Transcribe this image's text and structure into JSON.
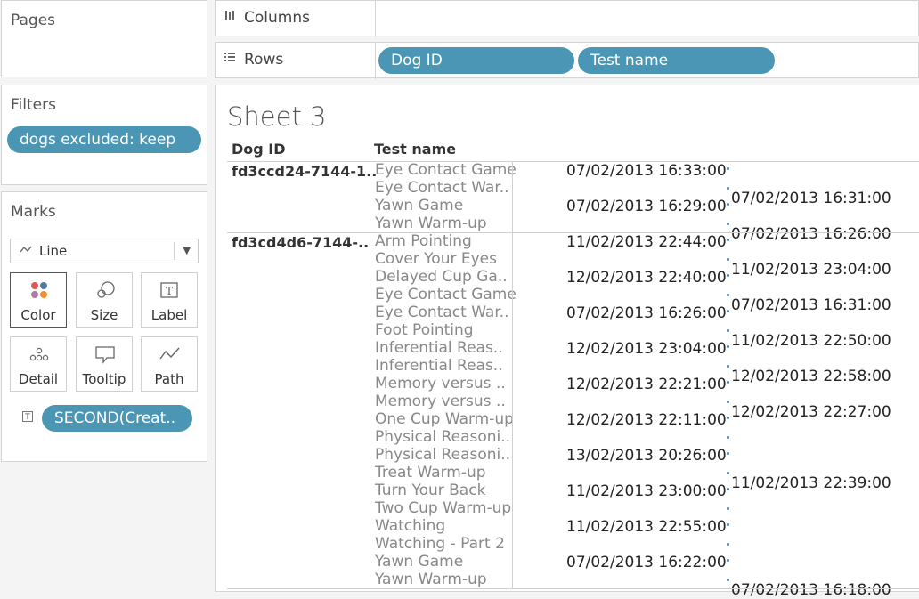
{
  "pages": {
    "title": "Pages"
  },
  "filters": {
    "title": "Filters",
    "pill": "dogs excluded: keep"
  },
  "marks": {
    "title": "Marks",
    "mark_type": {
      "icon": "line-icon",
      "label": "Line"
    },
    "buttons": [
      {
        "name": "color",
        "label": "Color",
        "icon": "color-icon",
        "active": true
      },
      {
        "name": "size",
        "label": "Size",
        "icon": "size-icon"
      },
      {
        "name": "label",
        "label": "Label",
        "icon": "label-icon"
      },
      {
        "name": "detail",
        "label": "Detail",
        "icon": "detail-icon"
      },
      {
        "name": "tooltip",
        "label": "Tooltip",
        "icon": "tooltip-icon"
      },
      {
        "name": "path",
        "label": "Path",
        "icon": "path-icon"
      }
    ],
    "field_pill": "SECOND(Creat.."
  },
  "shelves": {
    "columns": {
      "label": "Columns"
    },
    "rows": {
      "label": "Rows",
      "pills": [
        "Dog ID",
        "Test name"
      ]
    }
  },
  "sheet": {
    "title": "Sheet 3",
    "headers": {
      "dog_id": "Dog ID",
      "test_name": "Test name"
    },
    "groups": [
      {
        "dog_id": "fd3ccd24-7144-1..",
        "tests": [
          "Eye Contact Game",
          "Eye Contact War..",
          "Yawn Game",
          "Yawn Warm-up"
        ],
        "labels": [
          "07/02/2013 16:33:00",
          "07/02/2013 16:31:00",
          "07/02/2013 16:29:00",
          "07/02/2013 16:26:00"
        ]
      },
      {
        "dog_id": "fd3cd4d6-7144-..",
        "tests": [
          "Arm Pointing",
          "Cover Your Eyes",
          "Delayed Cup Ga..",
          "Eye Contact Game",
          "Eye Contact War..",
          "Foot Pointing",
          "Inferential Reas..",
          "Inferential Reas..",
          "Memory versus ..",
          "Memory versus ..",
          "One Cup Warm-up",
          "Physical Reasoni..",
          "Physical Reasoni..",
          "Treat Warm-up",
          "Turn Your Back",
          "Two Cup Warm-up",
          "Watching",
          "Watching - Part 2",
          "Yawn Game",
          "Yawn Warm-up"
        ],
        "labels": [
          "11/02/2013 22:44:00",
          "11/02/2013 23:04:00",
          "12/02/2013 22:40:00",
          "07/02/2013 16:31:00",
          "07/02/2013 16:26:00",
          "11/02/2013 22:50:00",
          "12/02/2013 23:04:00",
          "12/02/2013 22:58:00",
          "12/02/2013 22:21:00",
          "12/02/2013 22:27:00",
          "12/02/2013 22:11:00",
          "",
          "13/02/2013 20:26:00",
          "11/02/2013 22:39:00",
          "11/02/2013 23:00:00",
          "",
          "11/02/2013 22:55:00",
          "",
          "07/02/2013 16:22:00",
          "07/02/2013 16:18:00"
        ]
      }
    ],
    "colors": {
      "pill": "#4b96b4",
      "mark": "#4b78a8"
    }
  }
}
